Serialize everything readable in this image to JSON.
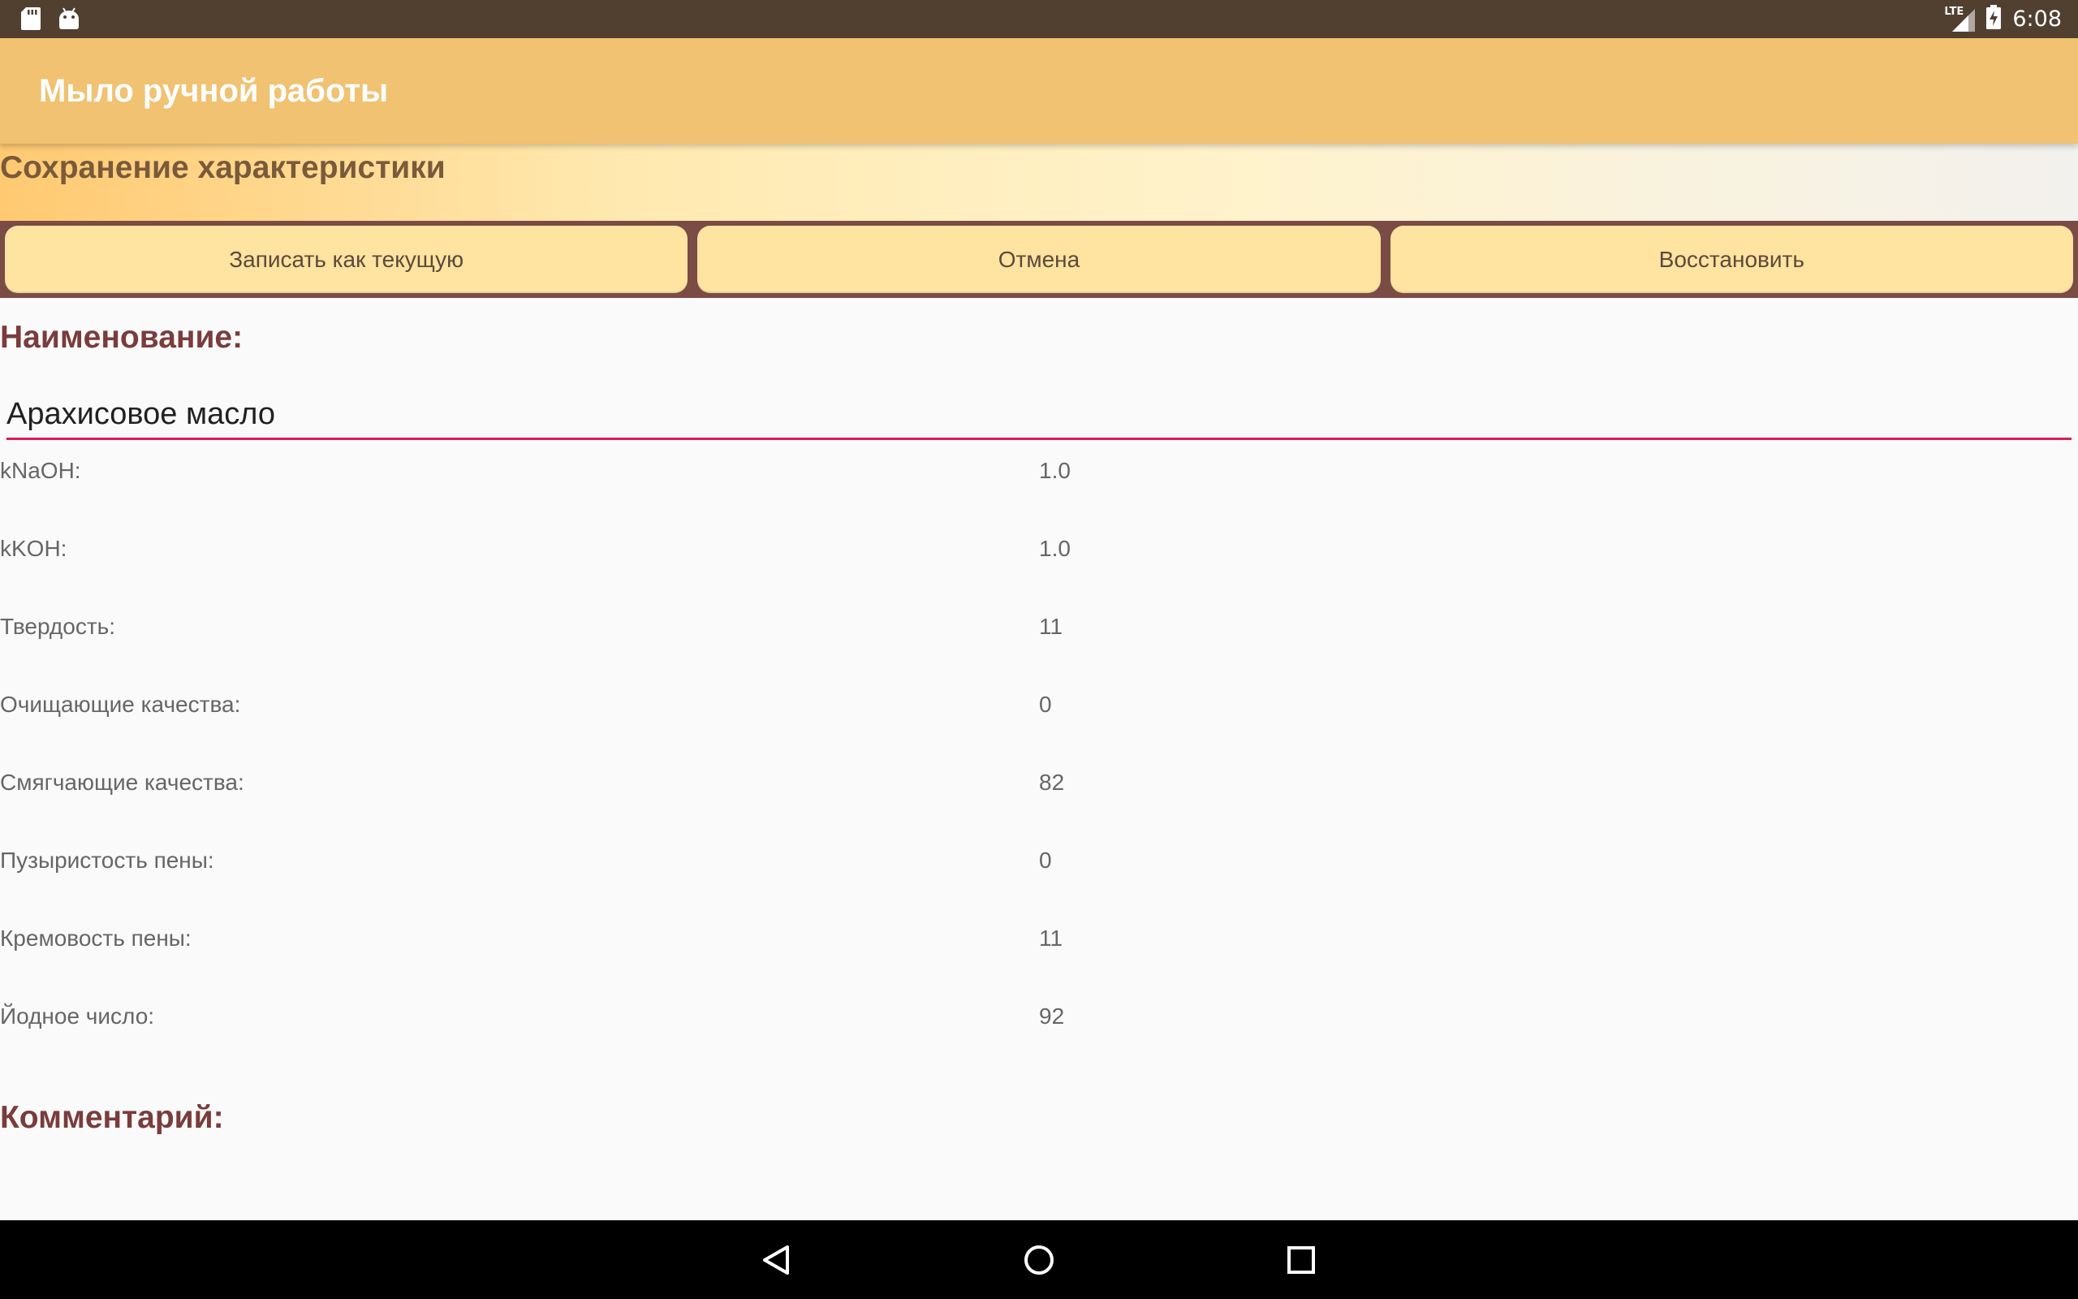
{
  "status_bar": {
    "time": "6:08",
    "network": "LTE",
    "icons_left": [
      "sd-card-icon",
      "android-icon"
    ],
    "icons_right": [
      "signal-icon",
      "battery-charging-icon"
    ]
  },
  "app_bar": {
    "title": "Мыло ручной работы"
  },
  "header": {
    "title": "Сохранение характеристики"
  },
  "buttons": {
    "save_current": "Записать как текущую",
    "cancel": "Отмена",
    "restore": "Восстановить"
  },
  "form": {
    "name_label": "Наименование:",
    "name_value": "Арахисовое масло",
    "properties": [
      {
        "label": "kNaOH:",
        "value": "1.0"
      },
      {
        "label": "kKOH:",
        "value": "1.0"
      },
      {
        "label": "Твердость:",
        "value": "11"
      },
      {
        "label": "Очищающие качества:",
        "value": "0"
      },
      {
        "label": "Смягчающие качества:",
        "value": "82"
      },
      {
        "label": "Пузыристость пены:",
        "value": "0"
      },
      {
        "label": "Кремовость пены:",
        "value": "11"
      },
      {
        "label": "Йодное число:",
        "value": "92"
      }
    ],
    "comment_label": "Комментарий:"
  },
  "nav_bar": {
    "icons": [
      "back-icon",
      "home-icon",
      "recents-icon"
    ]
  },
  "colors": {
    "status_bar": "#513f30",
    "app_bar": "#f0c272",
    "button_row_bg": "#7b4b45",
    "button": "#ffe3a0",
    "heading": "#7a3c3c",
    "input_underline": "#d81b60"
  }
}
